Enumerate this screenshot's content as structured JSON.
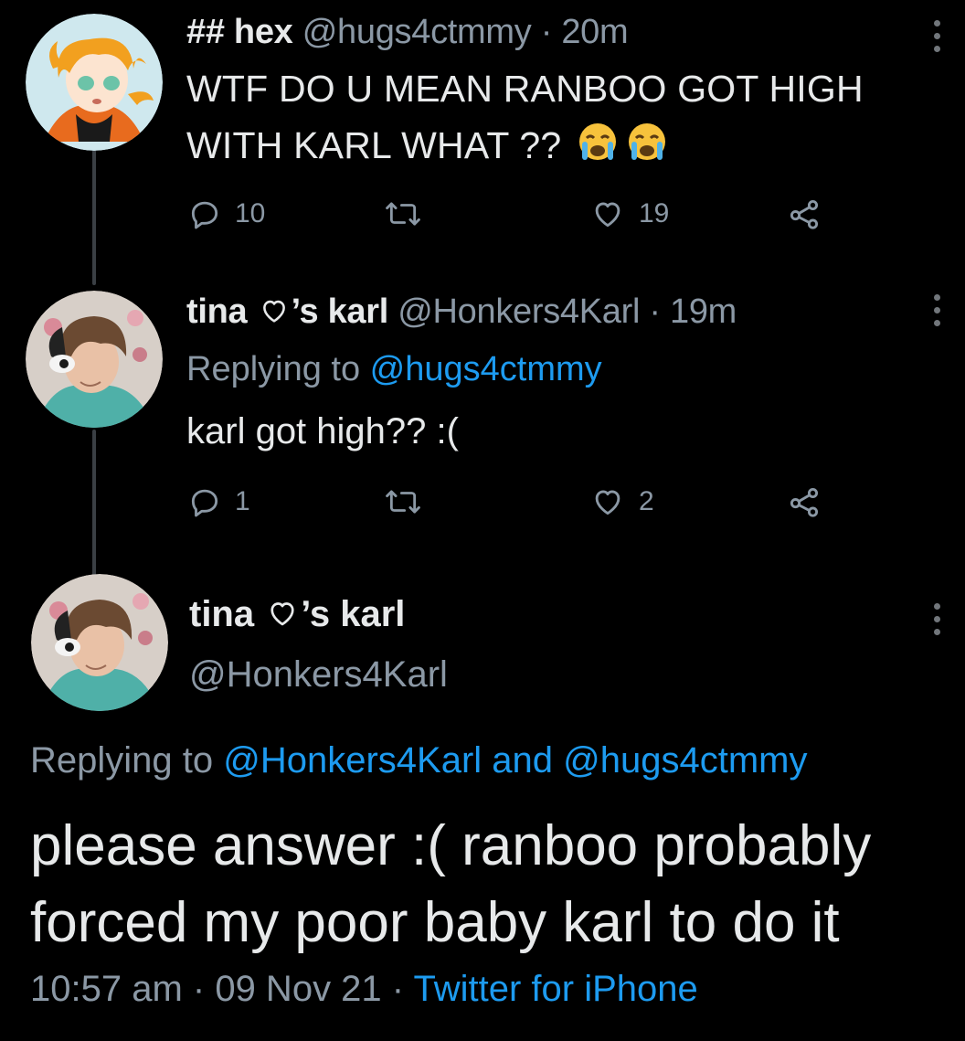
{
  "tweet1": {
    "name": "## hex",
    "handle": "@hugs4ctmmy",
    "sep": " · ",
    "time": "20m",
    "text_line1": "WTF DO U MEAN RANBOO GOT HIGH",
    "text_line2": "WITH KARL WHAT ??",
    "emoji": "crying-face-emoji",
    "replies": "10",
    "likes": "19"
  },
  "tweet2": {
    "name_part1": "tina ",
    "name_part2": "’s karl",
    "handle": "@Honkers4Karl",
    "sep": " · ",
    "time": "19m",
    "replying_label": "Replying to ",
    "replying_mention": "@hugs4ctmmy",
    "text": "karl got high?? :(",
    "replies": "1",
    "likes": "2"
  },
  "main_tweet": {
    "name_part1": "tina ",
    "name_part2": "’s karl",
    "handle": "@Honkers4Karl",
    "replying_label": "Replying to ",
    "mention1": "@Honkers4Karl",
    "and": " and ",
    "mention2": "@hugs4ctmmy",
    "text_line1": "please answer :( ranboo probably",
    "text_line2": "forced my poor baby karl to do it",
    "time": "10:57 am",
    "sep": " · ",
    "date": "09 Nov 21",
    "sep2": " · ",
    "source": "Twitter for iPhone"
  },
  "colors": {
    "background": "#000000",
    "text": "#e7e9ea",
    "muted": "#8b98a5",
    "link": "#1d9bf0",
    "thread_line": "#3a3f44"
  }
}
